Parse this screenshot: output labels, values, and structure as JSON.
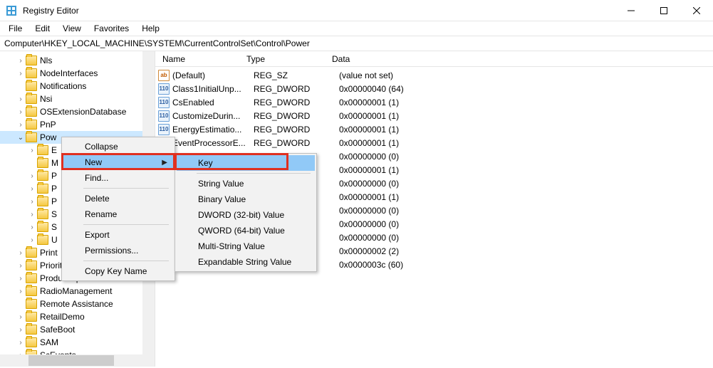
{
  "window": {
    "title": "Registry Editor"
  },
  "menu": {
    "file": "File",
    "edit": "Edit",
    "view": "View",
    "favorites": "Favorites",
    "help": "Help"
  },
  "address": "Computer\\HKEY_LOCAL_MACHINE\\SYSTEM\\CurrentControlSet\\Control\\Power",
  "tree_items": [
    {
      "indent": 22,
      "exp": ">",
      "label": "Nls"
    },
    {
      "indent": 22,
      "exp": ">",
      "label": "NodeInterfaces"
    },
    {
      "indent": 22,
      "exp": "",
      "label": "Notifications"
    },
    {
      "indent": 22,
      "exp": ">",
      "label": "Nsi"
    },
    {
      "indent": 22,
      "exp": ">",
      "label": "OSExtensionDatabase"
    },
    {
      "indent": 22,
      "exp": ">",
      "label": "PnP"
    },
    {
      "indent": 22,
      "exp": "v",
      "label": "Pow",
      "selected": true
    },
    {
      "indent": 38,
      "exp": ">",
      "label": "E"
    },
    {
      "indent": 38,
      "exp": "",
      "label": "M"
    },
    {
      "indent": 38,
      "exp": ">",
      "label": "P"
    },
    {
      "indent": 38,
      "exp": ">",
      "label": "P"
    },
    {
      "indent": 38,
      "exp": ">",
      "label": "P"
    },
    {
      "indent": 38,
      "exp": ">",
      "label": "S"
    },
    {
      "indent": 38,
      "exp": ">",
      "label": "S"
    },
    {
      "indent": 38,
      "exp": ">",
      "label": "U"
    },
    {
      "indent": 22,
      "exp": ">",
      "label": "Print"
    },
    {
      "indent": 22,
      "exp": ">",
      "label": "PriorityControl"
    },
    {
      "indent": 22,
      "exp": ">",
      "label": "ProductOptions"
    },
    {
      "indent": 22,
      "exp": ">",
      "label": "RadioManagement"
    },
    {
      "indent": 22,
      "exp": "",
      "label": "Remote Assistance"
    },
    {
      "indent": 22,
      "exp": ">",
      "label": "RetailDemo"
    },
    {
      "indent": 22,
      "exp": ">",
      "label": "SafeBoot"
    },
    {
      "indent": 22,
      "exp": ">",
      "label": "SAM"
    },
    {
      "indent": 22,
      "exp": ">",
      "label": "ScEvents"
    }
  ],
  "columns": {
    "name": "Name",
    "type": "Type",
    "data": "Data"
  },
  "values": [
    {
      "icon": "sz",
      "name": "(Default)",
      "type": "REG_SZ",
      "data": "(value not set)"
    },
    {
      "icon": "dw",
      "name": "Class1InitialUnp...",
      "type": "REG_DWORD",
      "data": "0x00000040 (64)"
    },
    {
      "icon": "dw",
      "name": "CsEnabled",
      "type": "REG_DWORD",
      "data": "0x00000001 (1)"
    },
    {
      "icon": "dw",
      "name": "CustomizeDurin...",
      "type": "REG_DWORD",
      "data": "0x00000001 (1)"
    },
    {
      "icon": "dw",
      "name": "EnergyEstimatio...",
      "type": "REG_DWORD",
      "data": "0x00000001 (1)"
    },
    {
      "icon": "dw",
      "name": "EventProcessorE...",
      "type": "REG_DWORD",
      "data": "0x00000001 (1)"
    },
    {
      "icon": "dw",
      "name": "",
      "type": "",
      "data": "0x00000000 (0)"
    },
    {
      "icon": "dw",
      "name": "",
      "type": "",
      "data": "0x00000001 (1)"
    },
    {
      "icon": "dw",
      "name": "",
      "type": "",
      "data": "0x00000000 (0)"
    },
    {
      "icon": "dw",
      "name": "",
      "type": "",
      "data": "0x00000001 (1)"
    },
    {
      "icon": "dw",
      "name": "",
      "type": "",
      "data": "0x00000000 (0)"
    },
    {
      "icon": "dw",
      "name": "",
      "type": "",
      "data": "0x00000000 (0)"
    },
    {
      "icon": "dw",
      "name": "",
      "type": "",
      "data": "0x00000000 (0)"
    },
    {
      "icon": "dw",
      "name": "",
      "type": "",
      "data": "0x00000002 (2)"
    },
    {
      "icon": "dw",
      "name": "",
      "type": "",
      "data": "0x0000003c (60)"
    }
  ],
  "context_menu": {
    "collapse": "Collapse",
    "new": "New",
    "find": "Find...",
    "delete": "Delete",
    "rename": "Rename",
    "export": "Export",
    "permissions": "Permissions...",
    "copy_key": "Copy Key Name"
  },
  "submenu": {
    "key": "Key",
    "string": "String Value",
    "binary": "Binary Value",
    "dword": "DWORD (32-bit) Value",
    "qword": "QWORD (64-bit) Value",
    "multi": "Multi-String Value",
    "expand": "Expandable String Value"
  }
}
